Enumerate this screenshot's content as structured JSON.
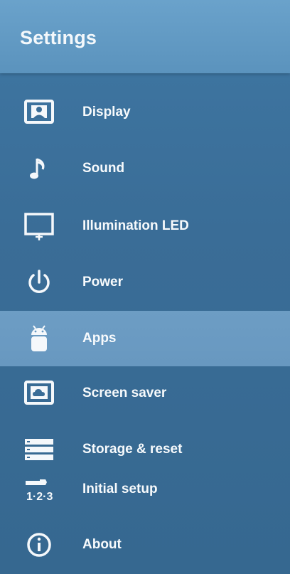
{
  "header": {
    "title": "Settings"
  },
  "menu": {
    "items": [
      {
        "label": "Display",
        "icon": "display-icon"
      },
      {
        "label": "Sound",
        "icon": "music-note-icon"
      },
      {
        "label": "Illumination LED",
        "icon": "illumination-led-icon"
      },
      {
        "label": "Power",
        "icon": "power-icon"
      },
      {
        "label": "Apps",
        "icon": "android-icon",
        "selected": true
      },
      {
        "label": "Screen saver",
        "icon": "screen-saver-icon"
      },
      {
        "label": "Storage & reset",
        "icon": "storage-icon"
      },
      {
        "label": "Initial setup",
        "icon": "initial-setup-icon"
      },
      {
        "label": "About",
        "icon": "info-icon"
      }
    ]
  },
  "colors": {
    "background": "#3a6d97",
    "header": "#5b93bd",
    "selected_row": "#6898c0",
    "text": "#f7fafc"
  }
}
